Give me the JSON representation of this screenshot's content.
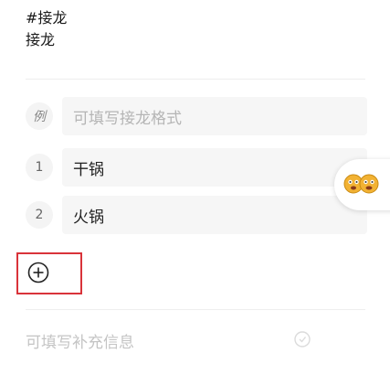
{
  "header": {
    "hashtag": "#接龙",
    "title": "接龙"
  },
  "example_row": {
    "badge": "例",
    "placeholder": "可填写接龙格式"
  },
  "entries": [
    {
      "number": "1",
      "text": "干锅"
    },
    {
      "number": "2",
      "text": "火锅"
    }
  ],
  "extra_info": {
    "placeholder": "可填写补充信息"
  },
  "icons": {
    "add": "add-circle-icon",
    "float": "emoji-faces-icon",
    "watermark": "watermark-logo-icon"
  },
  "colors": {
    "highlight": "#d9333a",
    "placeholder": "#b5b5b5",
    "row_bg": "#f6f6f6"
  }
}
